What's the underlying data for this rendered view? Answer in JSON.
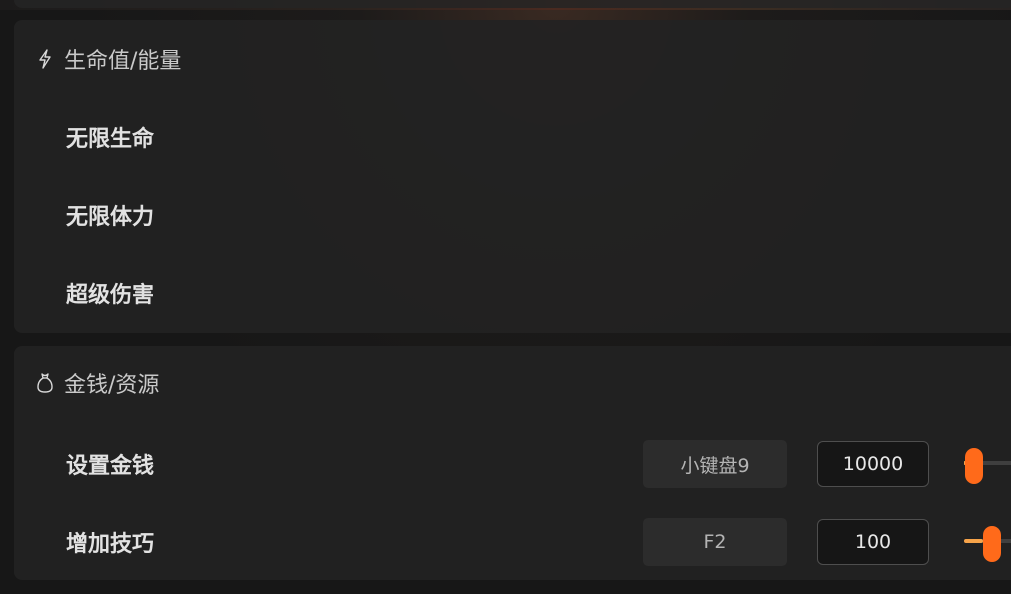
{
  "accent_color": "#ff6a1a",
  "sections": {
    "health": {
      "icon": "lightning-icon",
      "title": "生命值/能量",
      "rows": [
        {
          "label": "无限生命"
        },
        {
          "label": "无限体力"
        },
        {
          "label": "超级伤害"
        }
      ]
    },
    "money": {
      "icon": "money-bag-icon",
      "title": "金钱/资源",
      "rows": [
        {
          "label": "设置金钱",
          "hotkey": "小键盘9",
          "value": "10000",
          "slider_level": 0.0
        },
        {
          "label": "增加技巧",
          "hotkey": "F2",
          "value": "100",
          "slider_level": 0.3
        }
      ]
    }
  }
}
